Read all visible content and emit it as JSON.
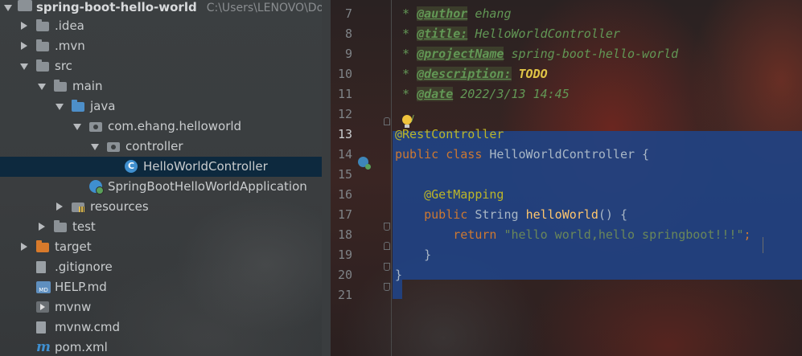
{
  "project": {
    "root": {
      "name": "spring-boot-hello-world",
      "path": "C:\\Users\\LENOVO\\Down"
    },
    "items": [
      {
        "label": ".idea",
        "arrow": "right",
        "icon": "folder-icon"
      },
      {
        "label": ".mvn",
        "arrow": "right",
        "icon": "folder-icon"
      },
      {
        "label": "src",
        "arrow": "down",
        "icon": "folder-icon"
      },
      {
        "label": "main",
        "arrow": "down",
        "icon": "folder-icon"
      },
      {
        "label": "java",
        "arrow": "down",
        "icon": "source-folder-icon"
      },
      {
        "label": "com.ehang.helloworld",
        "arrow": "down",
        "icon": "package-icon"
      },
      {
        "label": "controller",
        "arrow": "down",
        "icon": "package-icon"
      },
      {
        "label": "HelloWorldController",
        "arrow": "none",
        "icon": "java-class-icon",
        "selected": true
      },
      {
        "label": "SpringBootHelloWorldApplication",
        "arrow": "none",
        "icon": "spring-app-icon"
      },
      {
        "label": "resources",
        "arrow": "right",
        "icon": "resources-folder-icon"
      },
      {
        "label": "test",
        "arrow": "right",
        "icon": "folder-icon"
      },
      {
        "label": "target",
        "arrow": "right",
        "icon": "excluded-folder-icon"
      },
      {
        "label": ".gitignore",
        "arrow": "none",
        "icon": "gitignore-icon"
      },
      {
        "label": "HELP.md",
        "arrow": "none",
        "icon": "markdown-icon"
      },
      {
        "label": "mvnw",
        "arrow": "none",
        "icon": "shell-script-icon"
      },
      {
        "label": "mvnw.cmd",
        "arrow": "none",
        "icon": "text-file-icon"
      },
      {
        "label": "pom.xml",
        "arrow": "none",
        "icon": "maven-icon"
      }
    ],
    "class_icon_letter": "C",
    "md_icon_text": "MD"
  },
  "editor": {
    "current_line": 13,
    "lines": [
      {
        "n": "7",
        "prefix": " * ",
        "tag": "@author",
        "rest": " ehang"
      },
      {
        "n": "8",
        "prefix": " * ",
        "tag": "@title:",
        "rest": " HelloWorldController"
      },
      {
        "n": "9",
        "prefix": " * ",
        "tag": "@projectName",
        "rest": " spring-boot-hello-world"
      },
      {
        "n": "10",
        "prefix": " * ",
        "tag": "@description:",
        "rest": " TODO"
      },
      {
        "n": "11",
        "prefix": " * ",
        "tag": "@date",
        "rest": " 2022/3/13 14:45"
      },
      {
        "n": "12",
        "text": ""
      },
      {
        "n": "13",
        "annotation": "@RestController"
      },
      {
        "n": "14",
        "kw1": "public",
        "kw2": "class",
        "name": "HelloWorldController",
        "brace": " {"
      },
      {
        "n": "15",
        "text": ""
      },
      {
        "n": "16",
        "annotation": "@GetMapping",
        "indent": "    "
      },
      {
        "n": "17",
        "kw1": "public",
        "type": "String",
        "fn": "helloWorld",
        "sig": "() {",
        "indent": "    "
      },
      {
        "n": "18",
        "kw1": "return",
        "str": "\"hello world,hello springboot!!!\"",
        "end": ";",
        "indent": "        "
      },
      {
        "n": "19",
        "text": "    }"
      },
      {
        "n": "20",
        "text": "}"
      },
      {
        "n": "21",
        "text": ""
      }
    ]
  },
  "colors": {
    "selection": "#214283",
    "doc_comment": "#629755",
    "keyword": "#cc7832",
    "annotation": "#bbb529",
    "string": "#6a8759",
    "function": "#ffc66d"
  }
}
